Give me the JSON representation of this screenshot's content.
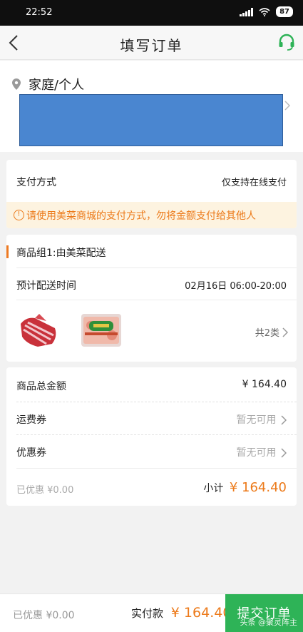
{
  "status": {
    "time": "22:52",
    "battery": "87"
  },
  "nav": {
    "title": "填写订单",
    "back_icon": "back-icon",
    "service_icon": "headset-icon",
    "accent": "#2eb357"
  },
  "address": {
    "label": "家庭/个人",
    "redacted_color": "#4a86d0"
  },
  "payment": {
    "label": "支付方式",
    "value": "仅支持在线支付",
    "warning": "请使用美菜商城的支付方式，勿将金额支付给其他人",
    "warning_icon": "!"
  },
  "goods": {
    "group_title": "商品组1:由美菜配送",
    "delivery_label": "预计配送时间",
    "delivery_value": "02月16日 06:00-20:00",
    "count_label": "共2类"
  },
  "summary": {
    "total_label": "商品总金额",
    "total_value": "¥ 164.40",
    "freight_label": "运费券",
    "freight_value": "暂无可用",
    "coupon_label": "优惠券",
    "coupon_value": "暂无可用",
    "discount_text": "已优惠 ¥0.00",
    "subtotal_label": "小计",
    "subtotal_value": "¥ 164.40"
  },
  "bottom": {
    "discount_text": "已优惠 ¥0.00",
    "paid_label": "实付款",
    "paid_value": "¥ 164.40",
    "submit_label": "提交订单",
    "watermark": "头条 @聚灵阵主"
  },
  "colors": {
    "orange": "#ec7a1a",
    "green": "#2eb357"
  }
}
